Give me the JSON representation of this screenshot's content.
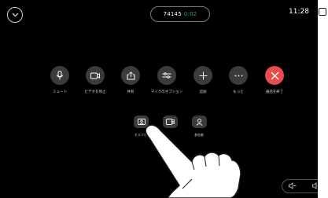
{
  "call": {
    "number": "74145",
    "duration": "0:02"
  },
  "clock": "11:28",
  "controls": [
    {
      "id": "mute",
      "label": "ミュート",
      "icon": "microphone-icon"
    },
    {
      "id": "stop-video",
      "label": "ビデオを停止",
      "icon": "video-camera-icon"
    },
    {
      "id": "share",
      "label": "共有",
      "icon": "share-icon"
    },
    {
      "id": "mic-options",
      "label": "マイクのオプション",
      "icon": "sliders-icon"
    },
    {
      "id": "add",
      "label": "追加",
      "icon": "plus-icon"
    },
    {
      "id": "more",
      "label": "もっと",
      "icon": "ellipsis-icon"
    },
    {
      "id": "end-call",
      "label": "通話を終了",
      "icon": "close-icon"
    }
  ],
  "secondary": [
    {
      "id": "selfview",
      "label": "セルフビ",
      "icon": "selfview-icon"
    },
    {
      "id": "layout",
      "label": "",
      "icon": "layout-icon"
    },
    {
      "id": "participants",
      "label": "参加者",
      "icon": "person-icon"
    }
  ],
  "colors": {
    "background": "#000000",
    "button": "#3b3b3b",
    "end_call": "#e94c4c",
    "timer": "#22b15a"
  }
}
